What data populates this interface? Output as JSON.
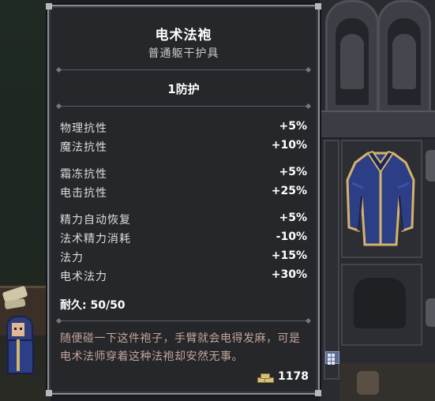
{
  "item": {
    "name": "电术法袍",
    "type": "普通躯干护具",
    "armor": "1防护",
    "stats": [
      {
        "label": "物理抗性",
        "value": "+5%"
      },
      {
        "label": "魔法抗性",
        "value": "+10%"
      },
      {
        "label": "霜冻抗性",
        "value": "+5%"
      },
      {
        "label": "电击抗性",
        "value": "+25%"
      },
      {
        "label": "精力自动恢复",
        "value": "+5%"
      },
      {
        "label": "法术精力消耗",
        "value": "-10%"
      },
      {
        "label": "法力",
        "value": "+15%"
      },
      {
        "label": "电术法力",
        "value": "+30%"
      }
    ],
    "durability": "耐久: 50/50",
    "description": "随便碰一下这件袍子，手臂就会电得发麻，可是电术法师穿着这种法袍却安然无事。",
    "price": "1178"
  },
  "icons": {
    "currency": "coin-stack-icon",
    "inventory_grid": "grid-icon",
    "item_preview": "robe-icon"
  },
  "colors": {
    "panel_bg": "#26272b",
    "panel_border": "#8a8c93",
    "description_text": "#c2a59a",
    "robe_blue": "#2c3e86",
    "robe_trim": "#d4b36a"
  }
}
